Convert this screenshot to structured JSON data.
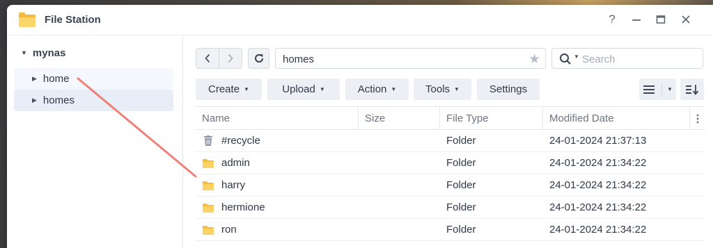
{
  "window": {
    "title": "File Station",
    "controls": {
      "help": "?",
      "minimize": "–",
      "maximize": "□",
      "close": "✕"
    }
  },
  "sidebar": {
    "root_label": "mynas",
    "items": [
      {
        "label": "home"
      },
      {
        "label": "homes"
      }
    ]
  },
  "toolbar": {
    "path_value": "homes",
    "search_placeholder": "Search",
    "buttons": {
      "create": "Create",
      "upload": "Upload",
      "action": "Action",
      "tools": "Tools",
      "settings": "Settings"
    }
  },
  "table": {
    "columns": {
      "name": "Name",
      "size": "Size",
      "type": "File Type",
      "modified": "Modified Date"
    },
    "rows": [
      {
        "icon": "trash-icon",
        "name": "#recycle",
        "size": "",
        "type": "Folder",
        "modified": "24-01-2024 21:37:13"
      },
      {
        "icon": "folder-icon",
        "name": "admin",
        "size": "",
        "type": "Folder",
        "modified": "24-01-2024 21:34:22"
      },
      {
        "icon": "folder-icon",
        "name": "harry",
        "size": "",
        "type": "Folder",
        "modified": "24-01-2024 21:34:22"
      },
      {
        "icon": "folder-icon",
        "name": "hermione",
        "size": "",
        "type": "Folder",
        "modified": "24-01-2024 21:34:22"
      },
      {
        "icon": "folder-icon",
        "name": "ron",
        "size": "",
        "type": "Folder",
        "modified": "24-01-2024 21:34:22"
      }
    ]
  },
  "colors": {
    "folder": "#f7c94a",
    "annotation_arrow": "#f07f78",
    "selected_bg": "#e8eef7"
  }
}
